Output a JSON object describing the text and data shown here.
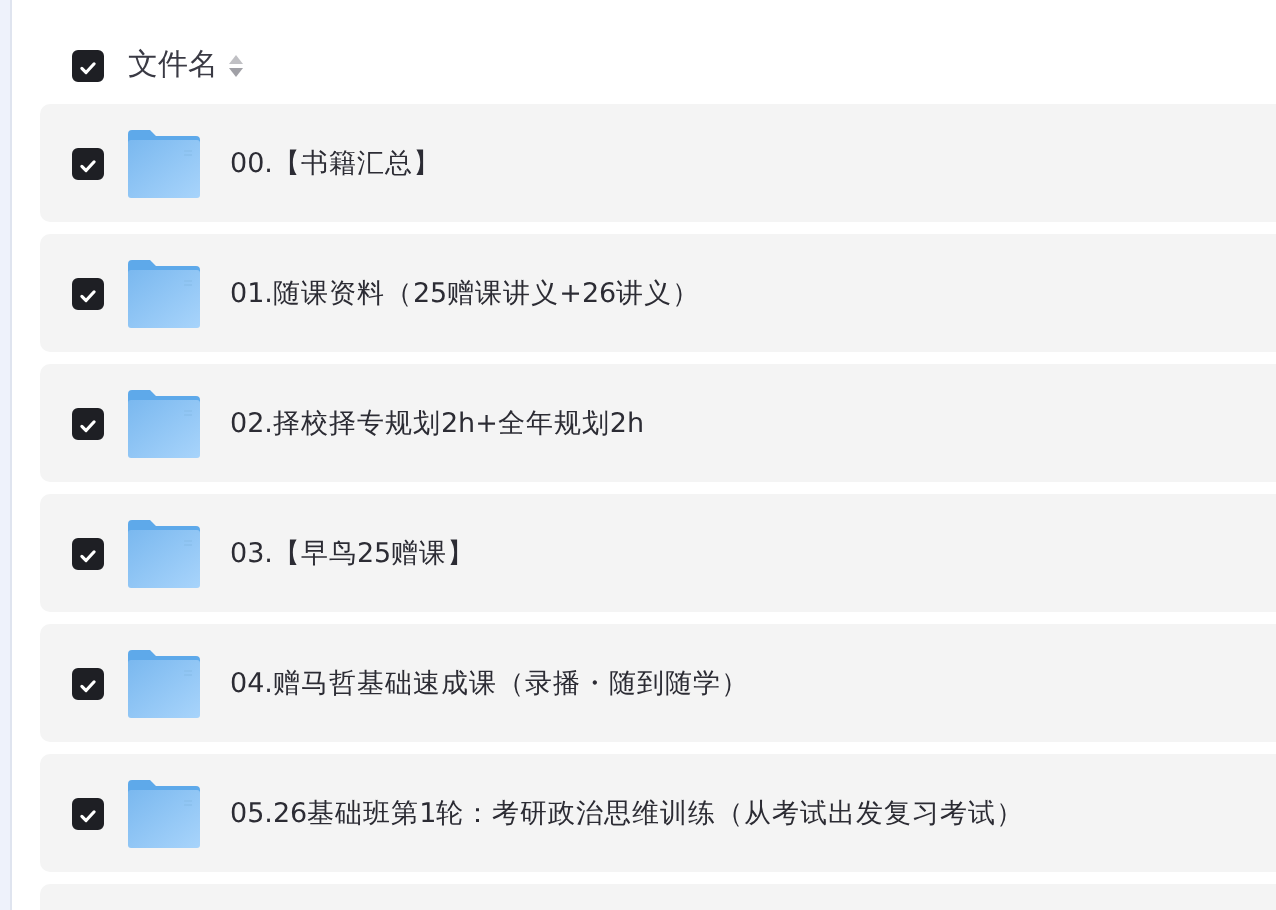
{
  "header": {
    "label": "文件名",
    "checked": true
  },
  "rows": [
    {
      "name": "00.【书籍汇总】",
      "checked": true
    },
    {
      "name": "01.随课资料（25赠课讲义+26讲义）",
      "checked": true
    },
    {
      "name": "02.择校择专规划2h+全年规划2h",
      "checked": true
    },
    {
      "name": "03.【早鸟25赠课】",
      "checked": true
    },
    {
      "name": "04.赠马哲基础速成课（录播・随到随学）",
      "checked": true
    },
    {
      "name": "05.26基础班第1轮：考研政治思维训练（从考试出发复习考试）",
      "checked": true
    }
  ]
}
